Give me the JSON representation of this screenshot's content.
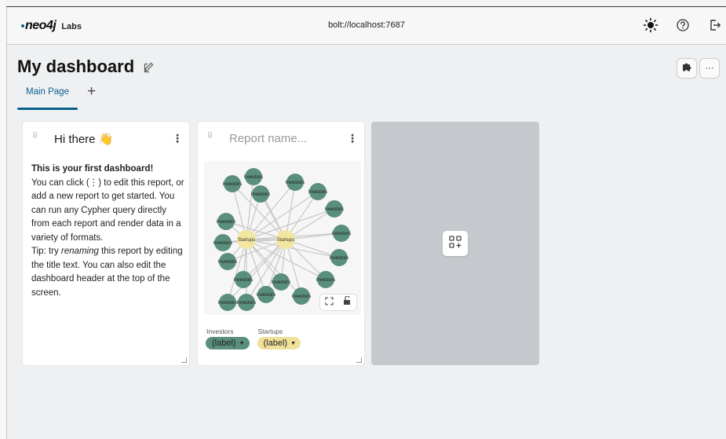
{
  "app": {
    "logo_word": "neo4j",
    "logo_suffix": "Labs",
    "connection": "bolt://localhost:7687"
  },
  "dashboard": {
    "title": "My dashboard",
    "tabs": [
      {
        "label": "Main Page",
        "active": true
      }
    ],
    "add_tab_symbol": "+"
  },
  "cards": [
    {
      "title": "Hi there 👋",
      "menu_symbol": "⋮",
      "heading": "This is your first dashboard!",
      "line1": "You can click (⋮) to edit this report, or add a new report to get started. You can run any Cypher query directly from each report and render data in a variety of formats.",
      "tip_prefix": "Tip: try ",
      "tip_emphasis": "renaming",
      "tip_suffix": " this report by editing the title text. You can also edit the dashboard header at the top of the screen."
    },
    {
      "title_placeholder": "Report name...",
      "menu_symbol": "⋮",
      "legend": [
        {
          "name": "Investors",
          "pill": "(label)",
          "color": "#5a8f7b"
        },
        {
          "name": "Startups",
          "pill": "(label)",
          "color": "#efe09a"
        }
      ],
      "node_labels": {
        "investor": "Investors",
        "startup": "Startups"
      }
    }
  ],
  "colors": {
    "accent": "#0a6190",
    "investor_node": "#5a8f7b",
    "startup_node": "#f2e6a0"
  },
  "icons": {
    "theme": "sun-icon",
    "help": "help-circle-icon",
    "logout": "logout-icon",
    "edit": "pencil-icon",
    "extensions": "puzzle-icon",
    "more": "more-horizontal-icon",
    "add_report": "add-report-icon"
  }
}
